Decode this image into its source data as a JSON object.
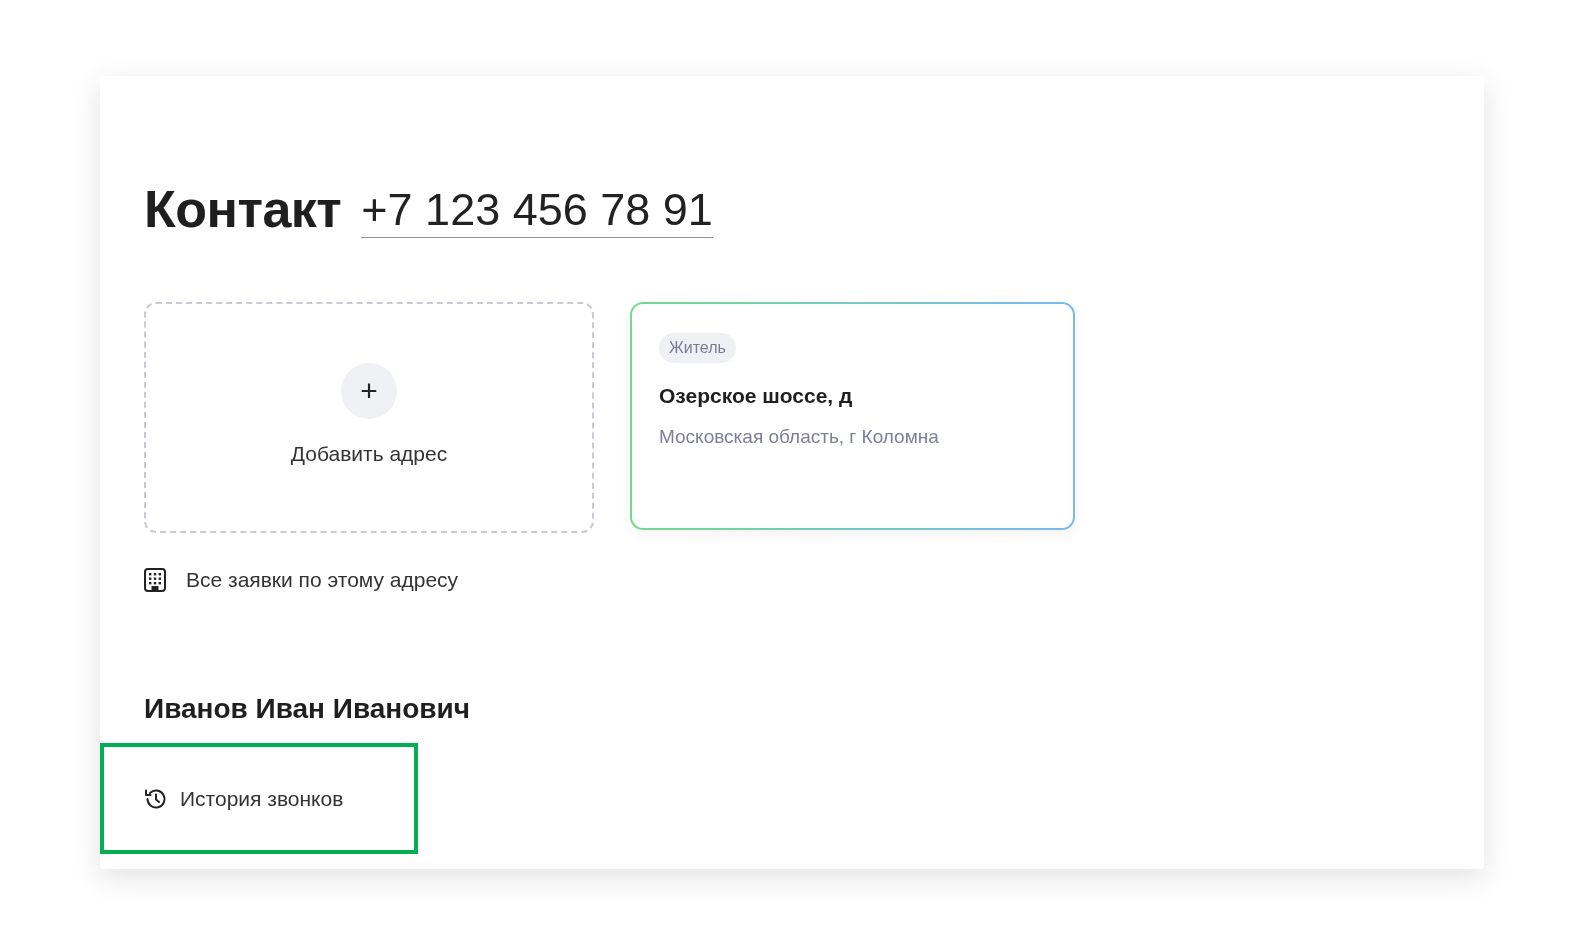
{
  "contact": {
    "title": "Контакт",
    "phone": "+7 123 456 78 91"
  },
  "addresses": {
    "add_icon": "+",
    "add_label": "Добавить адрес",
    "items": [
      {
        "badge": "Житель",
        "street": "Озерское шоссе, д",
        "locality": "Московская область, г Коломна",
        "selected": true
      }
    ]
  },
  "address_requests_link": "Все заявки по этому адресу",
  "person": {
    "name": "Иванов Иван Иванович",
    "call_history": {
      "label": "История звонков",
      "highlighted": true
    }
  }
}
